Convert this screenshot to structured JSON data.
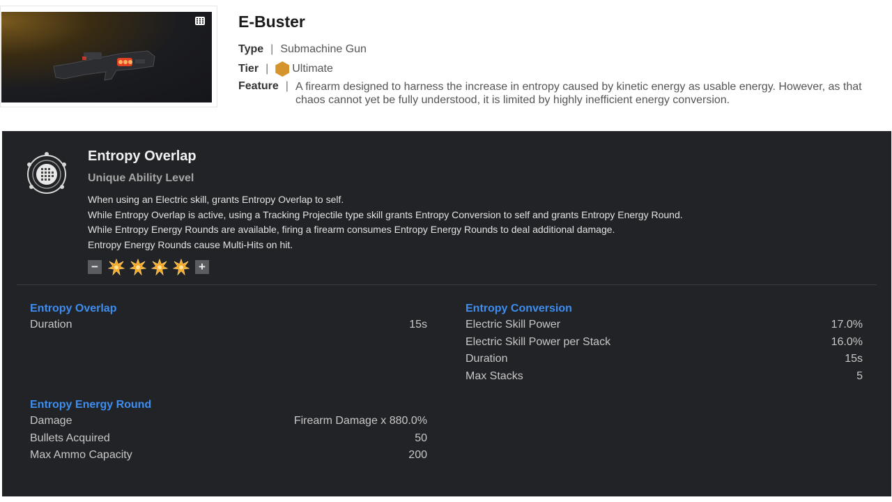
{
  "item": {
    "name": "E-Buster",
    "type_key": "Type",
    "type_value": "Submachine Gun",
    "tier_key": "Tier",
    "tier_value": "Ultimate",
    "tier_color": "#d4952e",
    "feature_key": "Feature",
    "feature_value": "A firearm designed to harness the increase in entropy caused by kinetic energy as usable energy. However, as that chaos cannot yet be fully understood, it is limited by highly inefficient energy conversion.",
    "separator": "|"
  },
  "ability": {
    "name": "Entropy Overlap",
    "subtitle": "Unique Ability Level",
    "description": [
      "When using an Electric skill, grants Entropy Overlap to self.",
      "While Entropy Overlap is active, using a Tracking Projectile type skill grants Entropy Conversion to self and grants Entropy Energy Round.",
      "While Entropy Energy Rounds are available, firing a firearm consumes Entropy Energy Rounds to deal additional damage.",
      "Entropy Energy Rounds cause Multi-Hits on hit."
    ],
    "level": {
      "minus_label": "−",
      "plus_label": "+",
      "filled": 4,
      "icon": "burst-icon",
      "icon_color": "#f5a623"
    }
  },
  "stats": {
    "overlap": {
      "title": "Entropy Overlap",
      "rows": [
        {
          "label": "Duration",
          "value": "15s"
        }
      ]
    },
    "energy_round": {
      "title": "Entropy Energy Round",
      "rows": [
        {
          "label": "Damage",
          "value": "Firearm Damage x 880.0%"
        },
        {
          "label": "Bullets Acquired",
          "value": "50"
        },
        {
          "label": "Max Ammo Capacity",
          "value": "200"
        }
      ]
    },
    "conversion": {
      "title": "Entropy Conversion",
      "rows": [
        {
          "label": "Electric Skill Power",
          "value": "17.0%"
        },
        {
          "label": "Electric Skill Power per Stack",
          "value": "16.0%"
        },
        {
          "label": "Duration",
          "value": "15s"
        },
        {
          "label": "Max Stacks",
          "value": "5"
        }
      ]
    }
  },
  "colors": {
    "panel_bg": "#222326",
    "accent_blue": "#3d8ef0"
  }
}
